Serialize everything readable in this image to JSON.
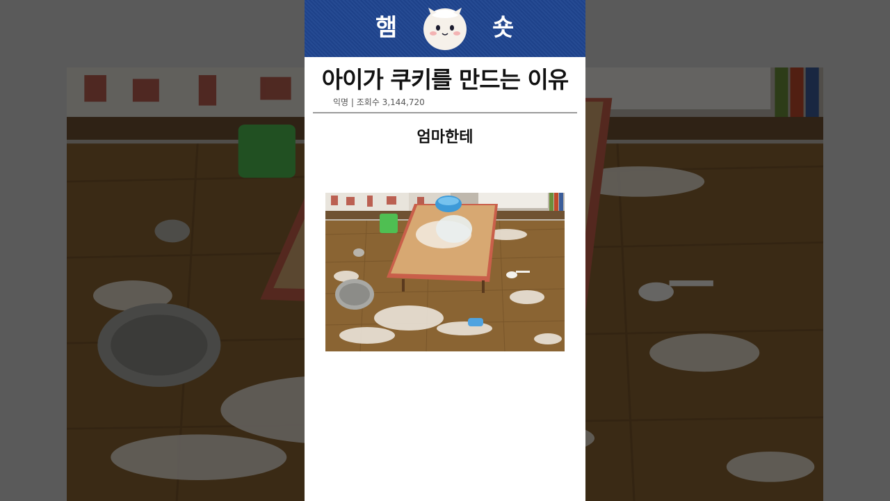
{
  "header": {
    "logo_left": "햄",
    "logo_right": "숏",
    "mascot_icon": "hamster-mascot-icon",
    "background_color": "#1f4590"
  },
  "post": {
    "title": "아이가 쿠키를 만드는 이유",
    "meta": "익명 | 조회수 3,144,720",
    "caption": "엄마한테"
  },
  "photo": {
    "subject": "floor covered in flour around a low wooden table"
  }
}
